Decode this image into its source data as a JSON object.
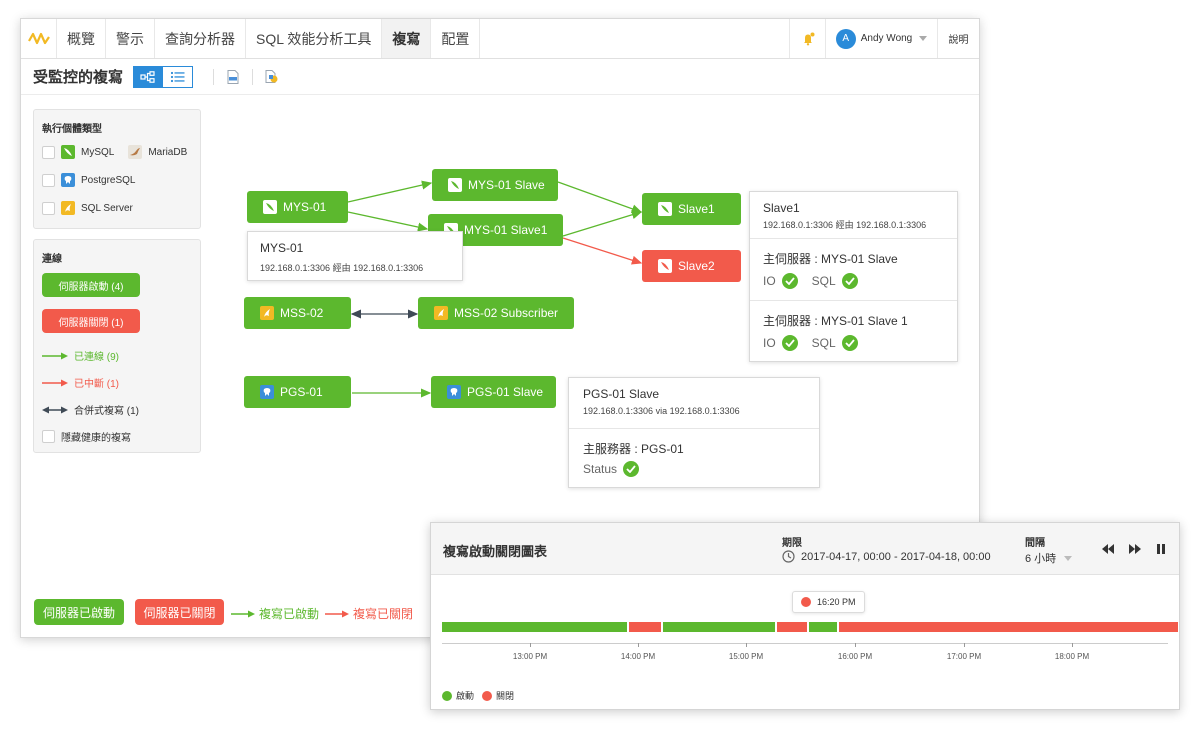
{
  "nav": {
    "items": [
      "概覽",
      "警示",
      "查詢分析器",
      "SQL 效能分析工具",
      "複寫",
      "配置"
    ],
    "active_index": 4,
    "user_initial": "A",
    "user_name": "Andy Wong",
    "help": "說明"
  },
  "header": {
    "title": "受監控的複寫"
  },
  "filters": {
    "instance_type_title": "執行個體類型",
    "types": [
      "MySQL",
      "MariaDB",
      "PostgreSQL",
      "SQL Server"
    ],
    "connections_title": "連線",
    "server_up": "伺服器啟動 (4)",
    "server_down": "伺服器關閉 (1)",
    "connected": "已連線 (9)",
    "broken": "已中斷 (1)",
    "merge": "合併式複寫 (1)",
    "hide_healthy": "隱藏健康的複寫"
  },
  "nodes": {
    "mys01": "MYS-01",
    "mys01_slave": "MYS-01 Slave",
    "mys01_slave1": "MYS-01 Slave1",
    "slave1": "Slave1",
    "slave2": "Slave2",
    "mss02": "MSS-02",
    "mss02_sub": "MSS-02 Subscriber",
    "pgs01": "PGS-01",
    "pgs01_slave": "PGS-01 Slave"
  },
  "popups": {
    "mys01": {
      "title": "MYS-01",
      "addr": "192.168.0.1:3306 經由 192.168.0.1:3306"
    },
    "slave1": {
      "title": "Slave1",
      "addr": "192.168.0.1:3306 經由 192.168.0.1:3306",
      "master1": "主伺服器 : MYS-01 Slave",
      "master2": "主伺服器 : MYS-01 Slave 1",
      "io": "IO",
      "sql": "SQL"
    },
    "pgs": {
      "title": "PGS-01 Slave",
      "addr": "192.168.0.1:3306 via 192.168.0.1:3306",
      "master": "主服務器 : PGS-01",
      "status": "Status"
    }
  },
  "legend": {
    "server_up": "伺服器已啟動",
    "server_down": "伺服器已關閉",
    "repl_up": "複寫已啟動",
    "repl_down": "複寫已關閉"
  },
  "colors": {
    "green": "#5cb82e",
    "red": "#f25a4b",
    "blue": "#2a8bd9",
    "dark": "#3f4a56"
  },
  "chart": {
    "title": "複寫啟動關閉圖表",
    "period_label": "期限",
    "period_value": "2017-04-17, 00:00 - 2017-04-18, 00:00",
    "interval_label": "間隔",
    "interval_value": "6 小時",
    "tooltip_time": "16:20 PM",
    "legend_on": "啟動",
    "legend_off": "關閉"
  },
  "chart_data": {
    "type": "timeline",
    "x_ticks": [
      "13:00 PM",
      "14:00 PM",
      "15:00 PM",
      "16:00 PM",
      "17:00 PM",
      "18:00 PM"
    ],
    "segments": [
      {
        "state": "on"
      },
      {
        "state": "off"
      },
      {
        "state": "on"
      },
      {
        "state": "off"
      },
      {
        "state": "on"
      },
      {
        "state": "off"
      }
    ]
  }
}
